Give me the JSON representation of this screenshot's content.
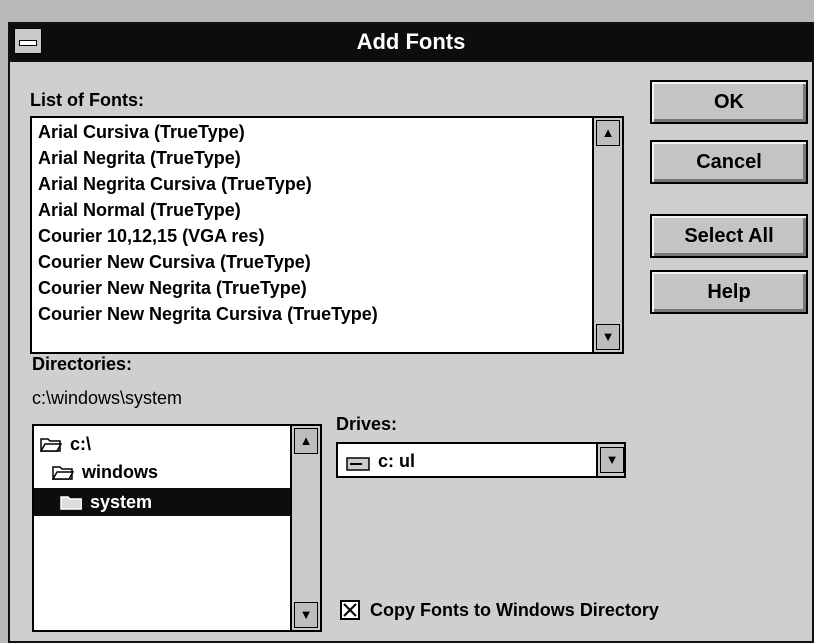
{
  "dialog": {
    "title": "Add Fonts",
    "fonts_label": "List of Fonts:",
    "fonts": [
      "Arial Cursiva (TrueType)",
      "Arial Negrita (TrueType)",
      "Arial Negrita Cursiva (TrueType)",
      "Arial Normal (TrueType)",
      "Courier 10,12,15 (VGA res)",
      "Courier New Cursiva (TrueType)",
      "Courier New Negrita (TrueType)",
      "Courier New Negrita Cursiva (TrueType)"
    ],
    "directories_label": "Directories:",
    "current_directory": "c:\\windows\\system",
    "directory_tree": [
      "c:\\",
      "windows",
      "system"
    ],
    "selected_directory": "system",
    "drives_label": "Drives:",
    "drive_value": "c: ul",
    "copy_label": "Copy Fonts to Windows Directory",
    "copy_checked": true,
    "buttons": {
      "ok": "OK",
      "cancel": "Cancel",
      "select_all": "Select All",
      "help": "Help"
    }
  }
}
